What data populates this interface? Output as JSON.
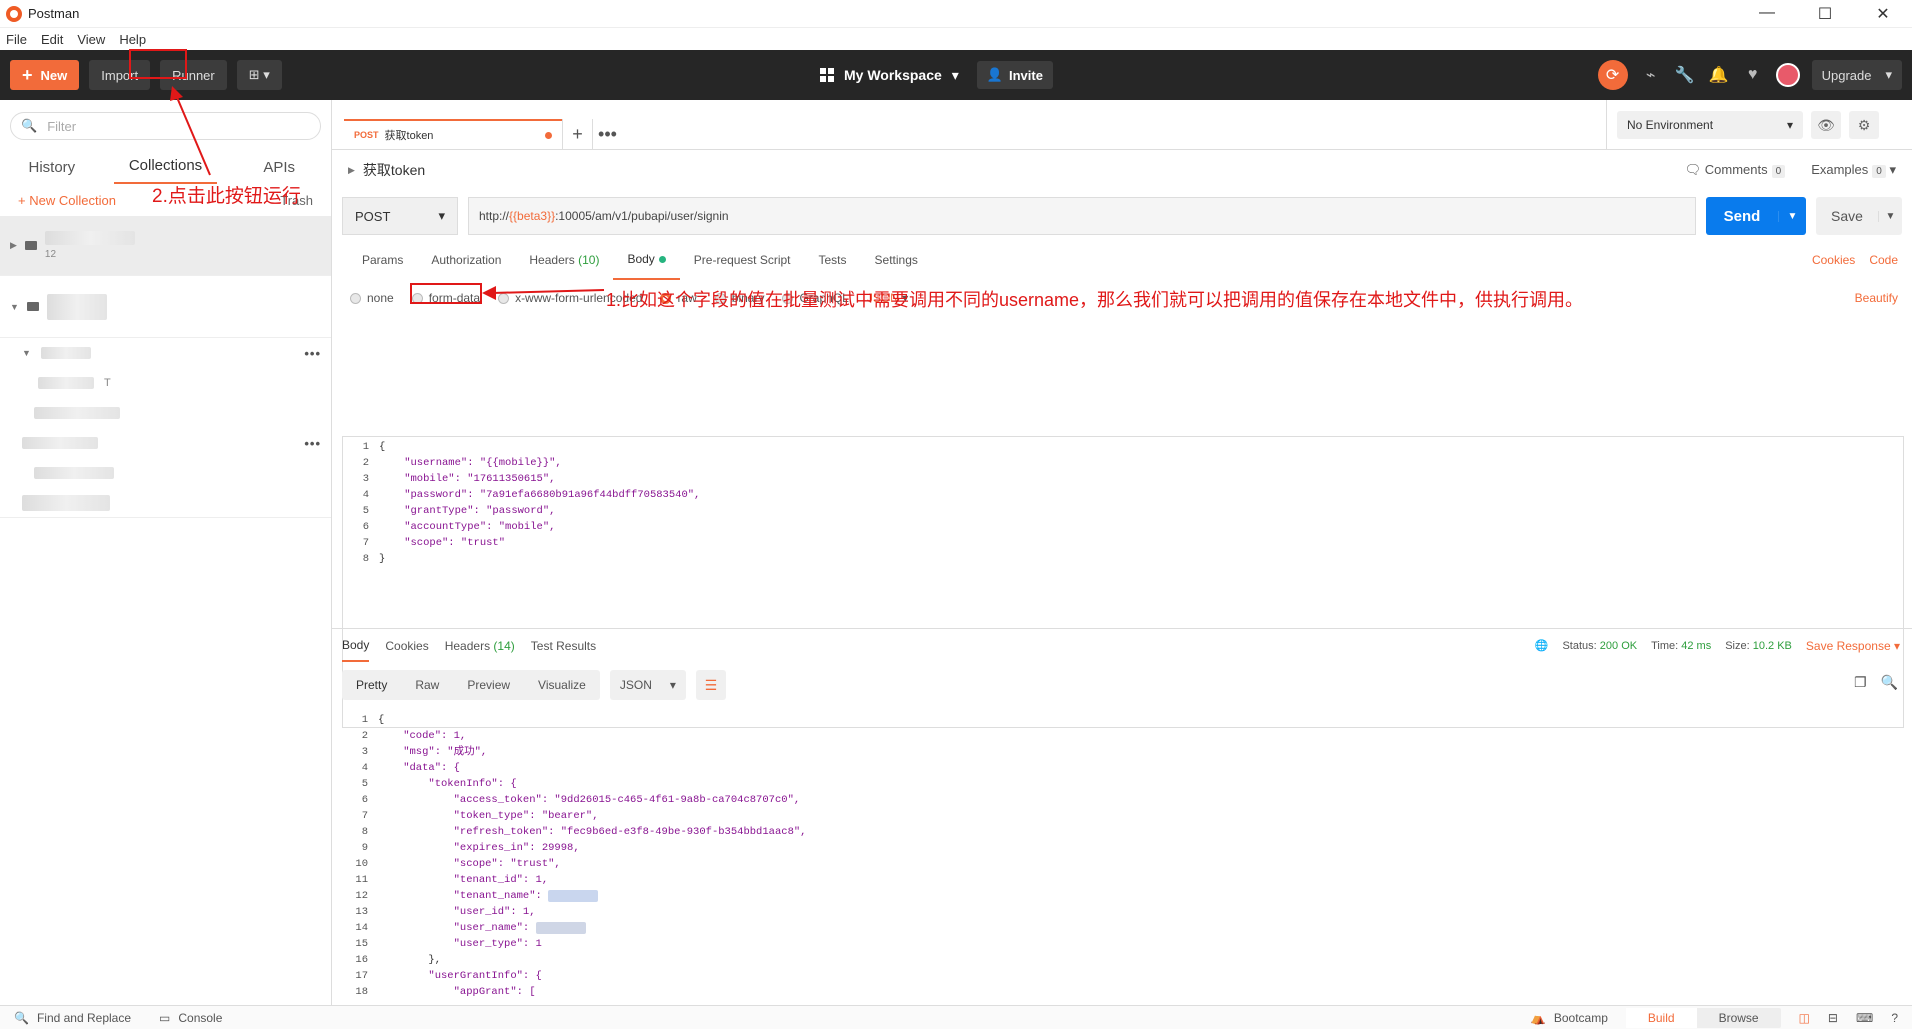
{
  "window": {
    "title": "Postman",
    "menu": [
      "File",
      "Edit",
      "View",
      "Help"
    ],
    "controls": [
      "—",
      "☐",
      "✕"
    ]
  },
  "toolbar": {
    "new_label": "New",
    "import_label": "Import",
    "runner_label": "Runner",
    "workspace_label": "My Workspace",
    "invite_label": "Invite",
    "upgrade_label": "Upgrade"
  },
  "sidebar": {
    "filter_placeholder": "Filter",
    "tabs": [
      "History",
      "Collections",
      "APIs"
    ],
    "new_collection_label": "New Collection",
    "trash_label": "Trash",
    "collection_count": "12",
    "item_suffix": "T"
  },
  "request": {
    "tab_method": "POST",
    "tab_name": "获取token",
    "name": "获取token",
    "comments_label": "Comments",
    "comments_count": "0",
    "examples_label": "Examples",
    "examples_count": "0",
    "method": "POST",
    "url_prefix": "http://",
    "url_var": "{{beta3}}",
    "url_suffix": ":10005/am/v1/pubapi/user/signin",
    "send_label": "Send",
    "save_label": "Save",
    "environment": "No Environment",
    "sub_tabs": {
      "params": "Params",
      "authorization": "Authorization",
      "headers": "Headers",
      "headers_count": "(10)",
      "body": "Body",
      "pre_request": "Pre-request Script",
      "tests": "Tests",
      "settings": "Settings"
    },
    "cookies_label": "Cookies",
    "code_label": "Code",
    "body_types": [
      "none",
      "form-data",
      "x-www-form-urlencoded",
      "raw",
      "binary",
      "GraphQL"
    ],
    "body_format": "JSON",
    "beautify_label": "Beautify",
    "body_lines": [
      "{",
      "    \"username\": \"{{mobile}}\",",
      "    \"mobile\": \"17611350615\",",
      "    \"password\": \"7a91efa6680b91a96f44bdff70583540\",",
      "    \"grantType\": \"password\",",
      "    \"accountType\": \"mobile\",",
      "    \"scope\": \"trust\"",
      "}"
    ]
  },
  "annotations": {
    "runner_note": "2.点击此按钮运行",
    "field_note": "1.比如这个字段的值在批量测试中需要调用不同的username，那么我们就可以把调用的值保存在本地文件中，供执行调用。"
  },
  "response": {
    "tabs": {
      "body": "Body",
      "cookies": "Cookies",
      "headers": "Headers",
      "headers_count": "(14)",
      "test_results": "Test Results"
    },
    "status_label": "Status:",
    "status_value": "200 OK",
    "time_label": "Time:",
    "time_value": "42 ms",
    "size_label": "Size:",
    "size_value": "10.2 KB",
    "save_response_label": "Save Response",
    "format_tabs": [
      "Pretty",
      "Raw",
      "Preview",
      "Visualize"
    ],
    "format_type": "JSON",
    "lines": [
      "{",
      "    \"code\": 1,",
      "    \"msg\": \"成功\",",
      "    \"data\": {",
      "        \"tokenInfo\": {",
      "            \"access_token\": \"9dd26015-c465-4f61-9a8b-ca704c8707c0\",",
      "            \"token_type\": \"bearer\",",
      "            \"refresh_token\": \"fec9b6ed-e3f8-49be-930f-b354bbd1aac8\",",
      "            \"expires_in\": 29998,",
      "            \"scope\": \"trust\",",
      "            \"tenant_id\": 1,",
      "            \"tenant_name\": ",
      "            \"user_id\": 1,",
      "            \"user_name\": ",
      "            \"user_type\": 1",
      "        },",
      "        \"userGrantInfo\": {",
      "            \"appGrant\": ["
    ]
  },
  "statusbar": {
    "find_replace": "Find and Replace",
    "console": "Console",
    "bootcamp": "Bootcamp",
    "build": "Build",
    "browse": "Browse"
  },
  "colors": {
    "accent": "#f26b3a",
    "send_blue": "#097bed",
    "annotation_red": "#e01818",
    "toolbar_bg": "#262626"
  }
}
